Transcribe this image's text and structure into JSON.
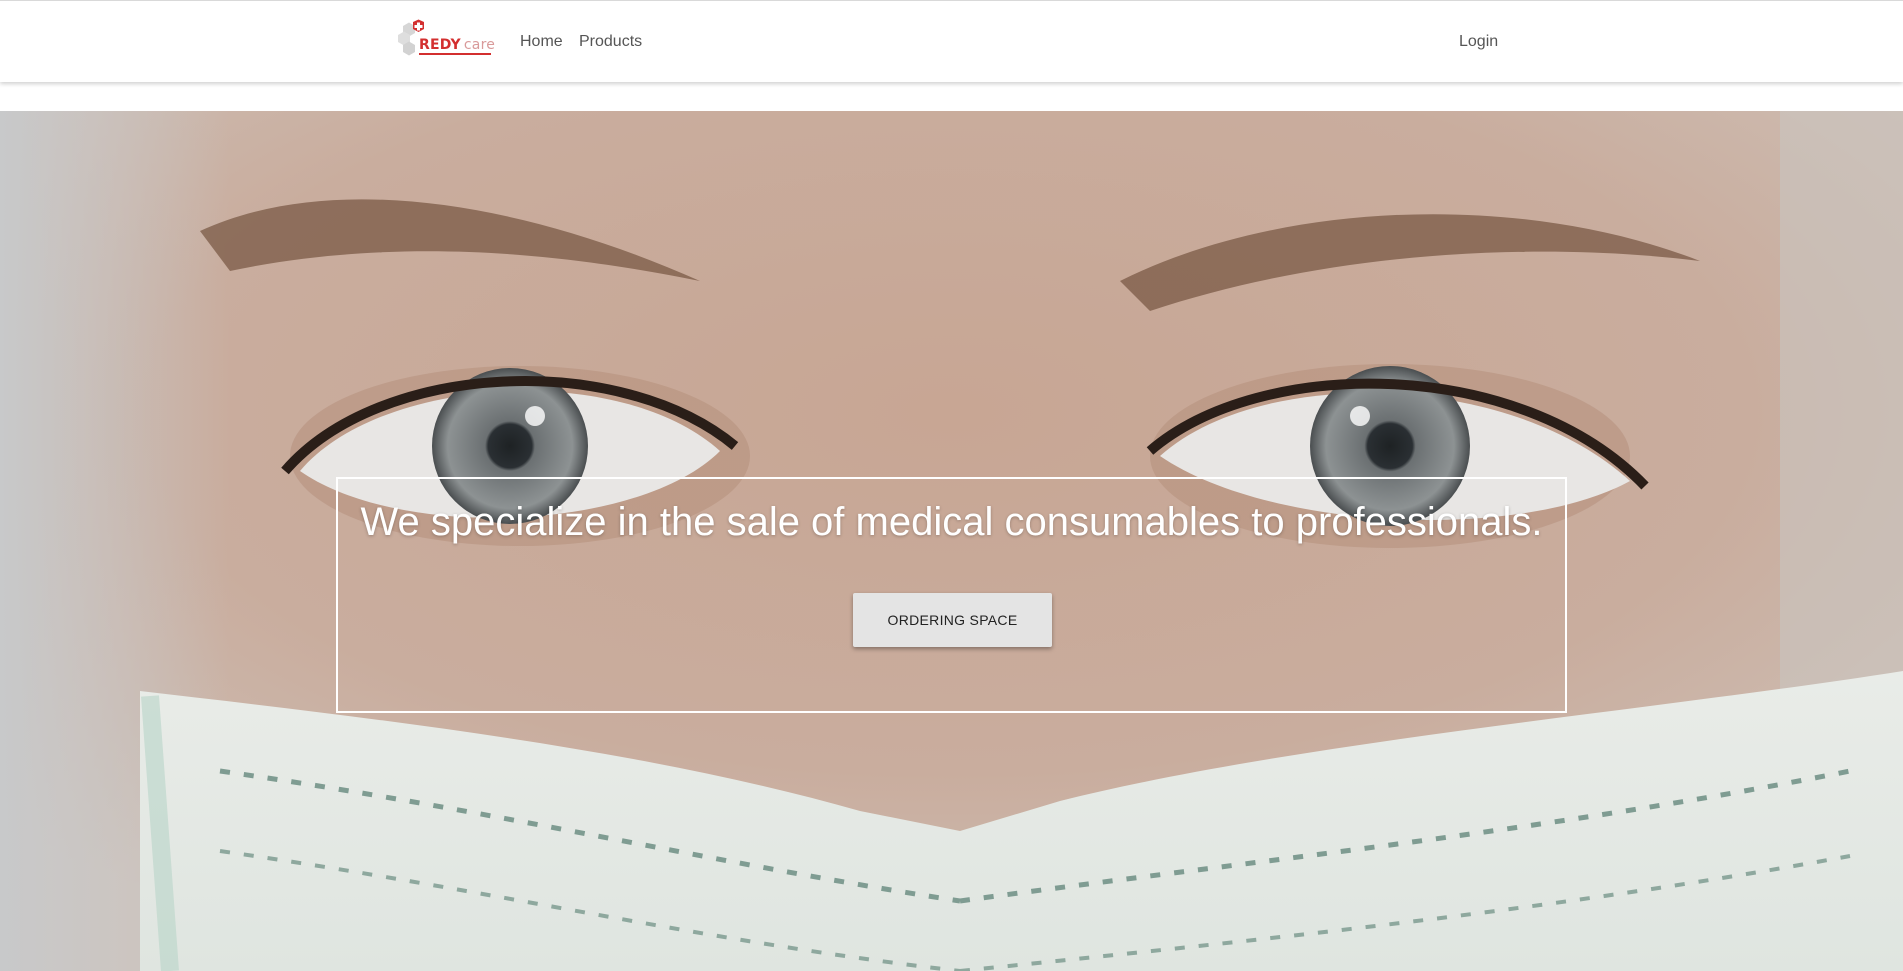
{
  "brand": {
    "name_primary": "REDY",
    "name_secondary": "care"
  },
  "nav": {
    "home_label": "Home",
    "products_label": "Products",
    "login_label": "Login"
  },
  "hero": {
    "headline": "We specialize in the sale of medical consumables to professionals.",
    "cta_label": "ORDERING SPACE",
    "image_subject": "close-up of a healthcare worker's eyes above a surgical mask"
  },
  "colors": {
    "brand_red": "#d32f2f",
    "nav_text": "#555555",
    "button_bg": "#e4e4e4",
    "hero_text": "#ffffff"
  },
  "icons": [
    "medical-cross-icon",
    "hexagon-icon"
  ]
}
